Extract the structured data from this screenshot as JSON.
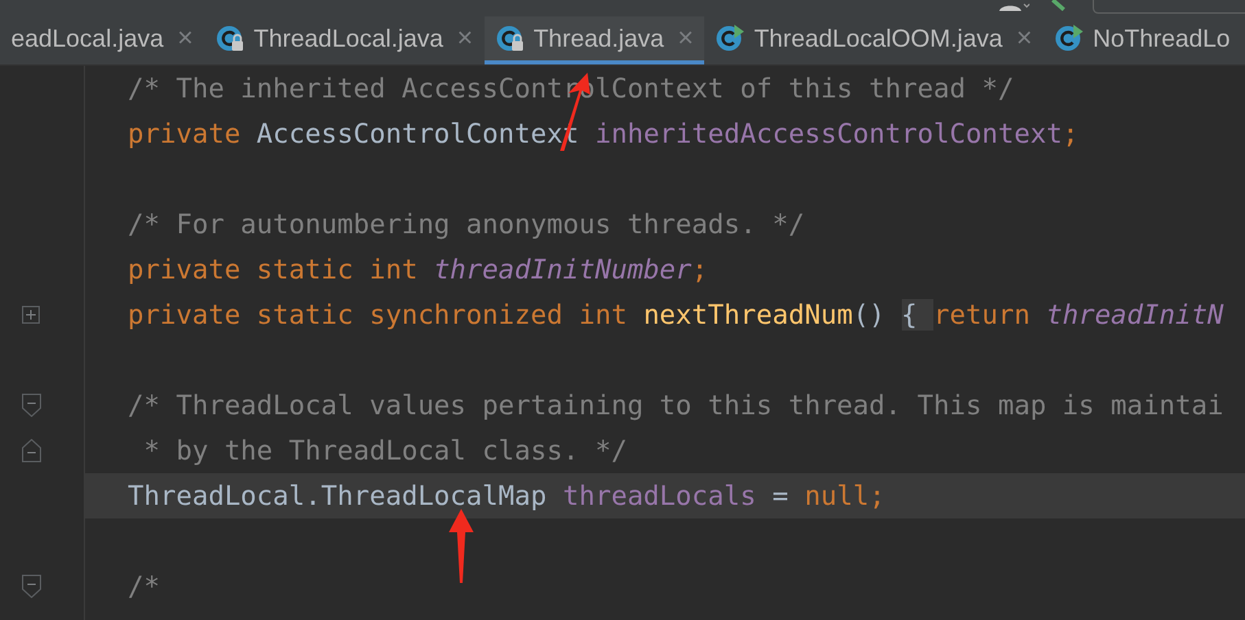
{
  "tabs": [
    {
      "label": "eadLocal.java",
      "kind": "plain",
      "selected": false,
      "close": "×"
    },
    {
      "label": "ThreadLocal.java",
      "kind": "locked",
      "selected": false,
      "close": "×"
    },
    {
      "label": "Thread.java",
      "kind": "locked",
      "selected": true,
      "close": "×"
    },
    {
      "label": "ThreadLocalOOM.java",
      "kind": "runnable",
      "selected": false,
      "close": "×"
    },
    {
      "label": "NoThreadLo",
      "kind": "runnable",
      "selected": false
    }
  ],
  "lines": [
    {
      "kind": "plain",
      "highlighted": false,
      "tokens": [
        {
          "kind": "comment",
          "text": "/* The inherited AccessControlContext of this thread */"
        }
      ]
    },
    {
      "kind": "plain",
      "highlighted": false,
      "tokens": [
        {
          "kind": "keyword",
          "text": "private "
        },
        {
          "kind": "plain",
          "text": "AccessControlContext "
        },
        {
          "kind": "field",
          "text": "inheritedAccessControlContext"
        },
        {
          "kind": "keyword",
          "text": ";"
        }
      ]
    },
    {
      "kind": "plain",
      "highlighted": false
    },
    {
      "kind": "plain",
      "highlighted": false,
      "tokens": [
        {
          "kind": "comment",
          "text": "/* For autonumbering anonymous threads. */"
        }
      ]
    },
    {
      "kind": "plain",
      "highlighted": false,
      "tokens": [
        {
          "kind": "keyword",
          "text": "private static int "
        },
        {
          "kind": "static",
          "text": "threadInitNumber"
        },
        {
          "kind": "keyword",
          "text": ";"
        }
      ]
    },
    {
      "kind": "folded",
      "highlighted": false,
      "tokens": [
        {
          "kind": "keyword",
          "text": "private static synchronized int "
        },
        {
          "kind": "method",
          "text": "nextThreadNum"
        },
        {
          "kind": "plain",
          "text": "() "
        },
        {
          "kind": "folded",
          "text": "{ "
        },
        {
          "kind": "keyword",
          "text": "return "
        },
        {
          "kind": "static",
          "text": "threadInitN"
        }
      ]
    },
    {
      "kind": "plain",
      "highlighted": false
    },
    {
      "kind": "fold-start",
      "highlighted": false,
      "tokens": [
        {
          "kind": "comment",
          "text": "/* ThreadLocal values pertaining to this thread. This map is maintai"
        }
      ]
    },
    {
      "kind": "fold-end",
      "highlighted": false,
      "tokens": [
        {
          "kind": "comment",
          "text": " * by the ThreadLocal class. */"
        }
      ]
    },
    {
      "kind": "plain",
      "highlighted": true,
      "tokens": [
        {
          "kind": "plain",
          "text": "ThreadLocal.ThreadLocalMap "
        },
        {
          "kind": "field",
          "text": "threadLocals"
        },
        {
          "kind": "plain",
          "text": " = "
        },
        {
          "kind": "keyword",
          "text": "null;"
        }
      ]
    },
    {
      "kind": "plain",
      "highlighted": false
    },
    {
      "kind": "fold-start",
      "highlighted": false,
      "tokens": [
        {
          "kind": "comment",
          "text": "/*"
        }
      ]
    }
  ]
}
